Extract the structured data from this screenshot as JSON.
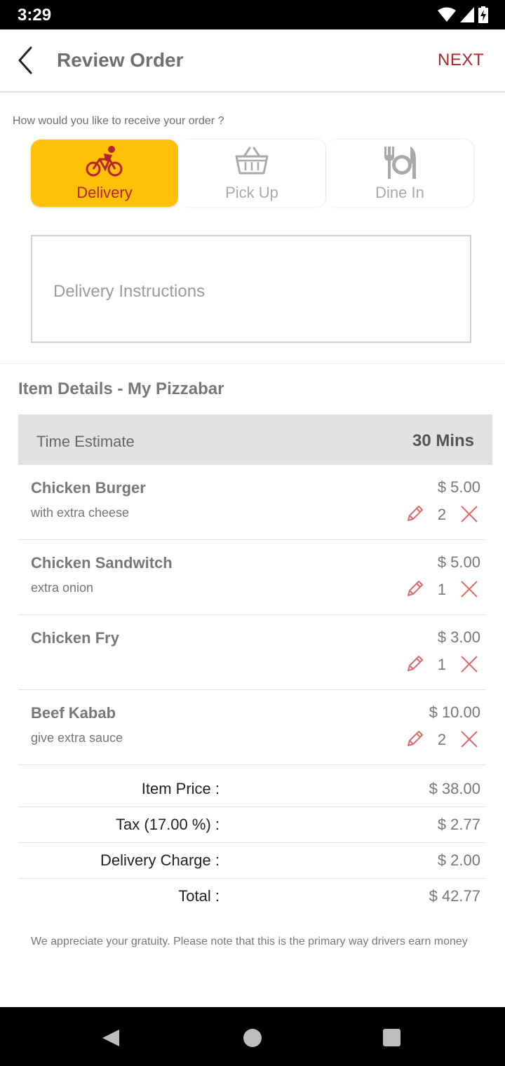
{
  "status_bar": {
    "time": "3:29"
  },
  "header": {
    "title": "Review Order",
    "next_label": "NEXT"
  },
  "order_type": {
    "question": "How would you like to receive your order ?",
    "options": [
      {
        "label": "Delivery",
        "icon": "bicycle-icon",
        "selected": true
      },
      {
        "label": "Pick Up",
        "icon": "basket-icon",
        "selected": false
      },
      {
        "label": "Dine In",
        "icon": "plate-cutlery-icon",
        "selected": false
      }
    ]
  },
  "instructions": {
    "placeholder": "Delivery Instructions"
  },
  "items_section": {
    "title": "Item Details - My Pizzabar",
    "time_estimate": {
      "label": "Time Estimate",
      "value": "30 Mins"
    },
    "items": [
      {
        "name": "Chicken Burger",
        "note": "with extra cheese",
        "price": "$ 5.00",
        "qty": "2"
      },
      {
        "name": "Chicken Sandwitch",
        "note": "extra onion",
        "price": "$ 5.00",
        "qty": "1"
      },
      {
        "name": "Chicken Fry",
        "note": "",
        "price": "$ 3.00",
        "qty": "1"
      },
      {
        "name": "Beef Kabab",
        "note": "give extra sauce",
        "price": "$ 10.00",
        "qty": "2"
      }
    ]
  },
  "summary": [
    {
      "label": "Item Price :",
      "value": "$ 38.00"
    },
    {
      "label": "Tax (17.00 %) :",
      "value": "$ 2.77"
    },
    {
      "label": "Delivery Charge :",
      "value": "$ 2.00"
    },
    {
      "label": "Total :",
      "value": "$ 42.77"
    }
  ],
  "gratuity_note": "We appreciate your gratuity. Please note that this is the primary way drivers earn money",
  "colors": {
    "accent": "#b3242a",
    "selected_bg": "#ffc107",
    "icon_gray": "#a9a9a9"
  }
}
